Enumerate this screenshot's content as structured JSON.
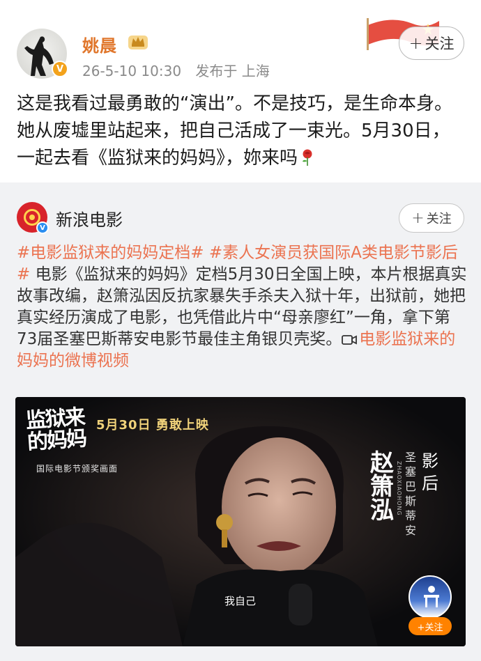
{
  "post": {
    "author_name": "姚晨",
    "vip_badge": "V",
    "time": "26-5-10 10:30",
    "source": "发布于 上海",
    "follow_label": "关注",
    "text": "这是我看过最勇敢的“演出”。不是技巧，是生命本身。她从废墟里站起来，把自己活成了一束光。5月30日，一起去看《监狱来的妈妈》，妳来吗"
  },
  "repost": {
    "author_name": "新浪电影",
    "follow_label": "关注",
    "hashtag1": "#电影监狱来的妈妈定档#",
    "hashtag2": "#素人女演员获国际A类电影节影后#",
    "body": " 电影《监狱来的妈妈》定档5月30日全国上映，本片根据真实故事改编，赵箫泓因反抗家暴失手杀夫入狱十年，出狱前，她把真实经历演成了电影，也凭借此片中“母亲廖红”一角，拿下第73届圣塞巴斯蒂安电影节最佳主角银贝壳奖。",
    "video_link": "电影监狱来的妈妈的微博视频"
  },
  "video": {
    "logo_text": "监狱来的妈妈",
    "date_text": "5月30日  勇敢上映",
    "caption_top": "国际电影节颁奖画面",
    "vertical_name": "赵箫泓",
    "pinyin": "ZHAOXIAOHONG",
    "small_vertical": "圣塞巴斯蒂安",
    "big_vertical": "影后",
    "subtitle": "我自己",
    "corner_follow": "+关注"
  },
  "colors": {
    "author_orange": "#e0762b",
    "link_orange": "#eb7350",
    "repost_bg": "#f1f2f4",
    "follow_orange": "#ff8200"
  }
}
